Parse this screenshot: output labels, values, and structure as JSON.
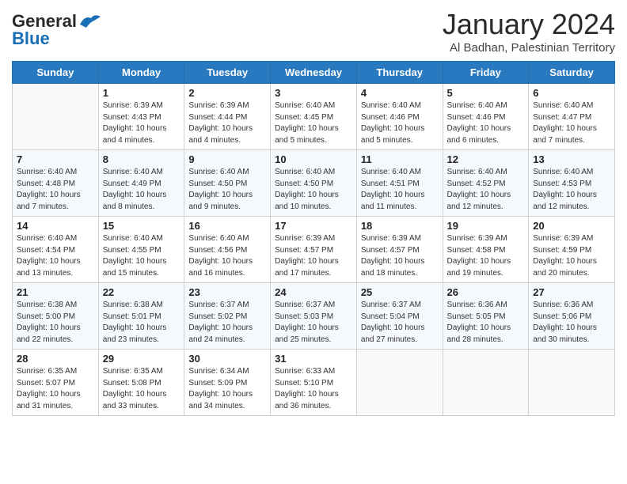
{
  "header": {
    "logo_general": "General",
    "logo_blue": "Blue",
    "title": "January 2024",
    "subtitle": "Al Badhan, Palestinian Territory"
  },
  "columns": [
    "Sunday",
    "Monday",
    "Tuesday",
    "Wednesday",
    "Thursday",
    "Friday",
    "Saturday"
  ],
  "weeks": [
    [
      {
        "day": "",
        "info": ""
      },
      {
        "day": "1",
        "info": "Sunrise: 6:39 AM\nSunset: 4:43 PM\nDaylight: 10 hours\nand 4 minutes."
      },
      {
        "day": "2",
        "info": "Sunrise: 6:39 AM\nSunset: 4:44 PM\nDaylight: 10 hours\nand 4 minutes."
      },
      {
        "day": "3",
        "info": "Sunrise: 6:40 AM\nSunset: 4:45 PM\nDaylight: 10 hours\nand 5 minutes."
      },
      {
        "day": "4",
        "info": "Sunrise: 6:40 AM\nSunset: 4:46 PM\nDaylight: 10 hours\nand 5 minutes."
      },
      {
        "day": "5",
        "info": "Sunrise: 6:40 AM\nSunset: 4:46 PM\nDaylight: 10 hours\nand 6 minutes."
      },
      {
        "day": "6",
        "info": "Sunrise: 6:40 AM\nSunset: 4:47 PM\nDaylight: 10 hours\nand 7 minutes."
      }
    ],
    [
      {
        "day": "7",
        "info": "Sunrise: 6:40 AM\nSunset: 4:48 PM\nDaylight: 10 hours\nand 7 minutes."
      },
      {
        "day": "8",
        "info": "Sunrise: 6:40 AM\nSunset: 4:49 PM\nDaylight: 10 hours\nand 8 minutes."
      },
      {
        "day": "9",
        "info": "Sunrise: 6:40 AM\nSunset: 4:50 PM\nDaylight: 10 hours\nand 9 minutes."
      },
      {
        "day": "10",
        "info": "Sunrise: 6:40 AM\nSunset: 4:50 PM\nDaylight: 10 hours\nand 10 minutes."
      },
      {
        "day": "11",
        "info": "Sunrise: 6:40 AM\nSunset: 4:51 PM\nDaylight: 10 hours\nand 11 minutes."
      },
      {
        "day": "12",
        "info": "Sunrise: 6:40 AM\nSunset: 4:52 PM\nDaylight: 10 hours\nand 12 minutes."
      },
      {
        "day": "13",
        "info": "Sunrise: 6:40 AM\nSunset: 4:53 PM\nDaylight: 10 hours\nand 12 minutes."
      }
    ],
    [
      {
        "day": "14",
        "info": "Sunrise: 6:40 AM\nSunset: 4:54 PM\nDaylight: 10 hours\nand 13 minutes."
      },
      {
        "day": "15",
        "info": "Sunrise: 6:40 AM\nSunset: 4:55 PM\nDaylight: 10 hours\nand 15 minutes."
      },
      {
        "day": "16",
        "info": "Sunrise: 6:40 AM\nSunset: 4:56 PM\nDaylight: 10 hours\nand 16 minutes."
      },
      {
        "day": "17",
        "info": "Sunrise: 6:39 AM\nSunset: 4:57 PM\nDaylight: 10 hours\nand 17 minutes."
      },
      {
        "day": "18",
        "info": "Sunrise: 6:39 AM\nSunset: 4:57 PM\nDaylight: 10 hours\nand 18 minutes."
      },
      {
        "day": "19",
        "info": "Sunrise: 6:39 AM\nSunset: 4:58 PM\nDaylight: 10 hours\nand 19 minutes."
      },
      {
        "day": "20",
        "info": "Sunrise: 6:39 AM\nSunset: 4:59 PM\nDaylight: 10 hours\nand 20 minutes."
      }
    ],
    [
      {
        "day": "21",
        "info": "Sunrise: 6:38 AM\nSunset: 5:00 PM\nDaylight: 10 hours\nand 22 minutes."
      },
      {
        "day": "22",
        "info": "Sunrise: 6:38 AM\nSunset: 5:01 PM\nDaylight: 10 hours\nand 23 minutes."
      },
      {
        "day": "23",
        "info": "Sunrise: 6:37 AM\nSunset: 5:02 PM\nDaylight: 10 hours\nand 24 minutes."
      },
      {
        "day": "24",
        "info": "Sunrise: 6:37 AM\nSunset: 5:03 PM\nDaylight: 10 hours\nand 25 minutes."
      },
      {
        "day": "25",
        "info": "Sunrise: 6:37 AM\nSunset: 5:04 PM\nDaylight: 10 hours\nand 27 minutes."
      },
      {
        "day": "26",
        "info": "Sunrise: 6:36 AM\nSunset: 5:05 PM\nDaylight: 10 hours\nand 28 minutes."
      },
      {
        "day": "27",
        "info": "Sunrise: 6:36 AM\nSunset: 5:06 PM\nDaylight: 10 hours\nand 30 minutes."
      }
    ],
    [
      {
        "day": "28",
        "info": "Sunrise: 6:35 AM\nSunset: 5:07 PM\nDaylight: 10 hours\nand 31 minutes."
      },
      {
        "day": "29",
        "info": "Sunrise: 6:35 AM\nSunset: 5:08 PM\nDaylight: 10 hours\nand 33 minutes."
      },
      {
        "day": "30",
        "info": "Sunrise: 6:34 AM\nSunset: 5:09 PM\nDaylight: 10 hours\nand 34 minutes."
      },
      {
        "day": "31",
        "info": "Sunrise: 6:33 AM\nSunset: 5:10 PM\nDaylight: 10 hours\nand 36 minutes."
      },
      {
        "day": "",
        "info": ""
      },
      {
        "day": "",
        "info": ""
      },
      {
        "day": "",
        "info": ""
      }
    ]
  ]
}
